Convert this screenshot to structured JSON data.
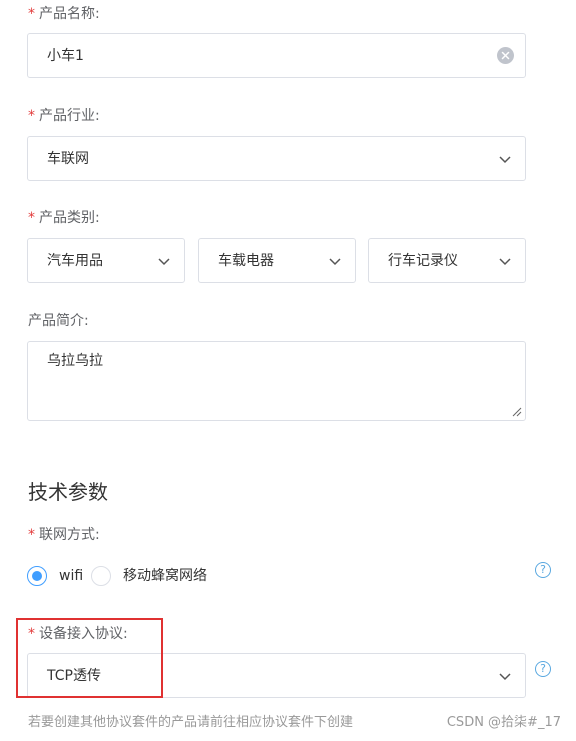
{
  "product_name": {
    "label": "产品名称:",
    "value": "小车1",
    "required": true
  },
  "industry": {
    "label": "产品行业:",
    "value": "车联网",
    "required": true
  },
  "category": {
    "label": "产品类别:",
    "values": [
      "汽车用品",
      "车载电器",
      "行车记录仪"
    ],
    "required": true
  },
  "description": {
    "label": "产品简介:",
    "value": "乌拉乌拉"
  },
  "tech_section": {
    "title": "技术参数"
  },
  "network": {
    "label": "联网方式:",
    "required": true,
    "options": [
      "wifi",
      "移动蜂窝网络"
    ],
    "selected": "wifi"
  },
  "protocol": {
    "label": "设备接入协议:",
    "value": "TCP透传",
    "required": true
  },
  "hint": "若要创建其他协议套件的产品请前往相应协议套件下创建",
  "watermark": "CSDN @拾柒#_17",
  "required_mark": "*",
  "help_glyph": "?",
  "colors": {
    "accent": "#409eff",
    "required": "#e23b3b",
    "highlight": "#e03131",
    "border": "#dcdfe6"
  }
}
